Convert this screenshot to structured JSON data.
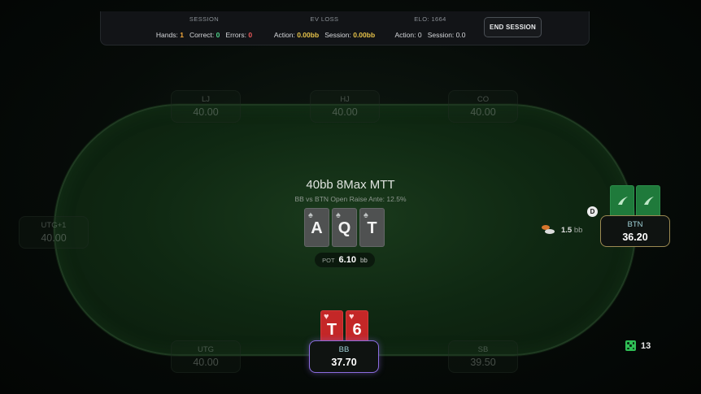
{
  "stats": {
    "session": {
      "header": "SESSION",
      "hands_label": "Hands:",
      "hands": "1",
      "correct_label": "Correct:",
      "correct": "0",
      "errors_label": "Errors:",
      "errors": "0"
    },
    "ev_loss": {
      "header": "EV LOSS",
      "action_label": "Action:",
      "action": "0.00bb",
      "session_label": "Session:",
      "session": "0.00bb"
    },
    "elo": {
      "header": "ELO: 1664",
      "action_label": "Action:",
      "action": "0",
      "session_label": "Session:",
      "session": "0.0"
    },
    "end_button": "END SESSION"
  },
  "table": {
    "title": "40bb 8Max MTT",
    "subtitle": "BB vs BTN Open Raise Ante: 12.5%",
    "pot_label": "POT",
    "pot_value": "6.10",
    "pot_unit": "bb"
  },
  "seats": [
    {
      "id": "lj",
      "pos": "LJ",
      "stack": "40.00"
    },
    {
      "id": "hj",
      "pos": "HJ",
      "stack": "40.00"
    },
    {
      "id": "co",
      "pos": "CO",
      "stack": "40.00"
    },
    {
      "id": "utg1",
      "pos": "UTG+1",
      "stack": "40.00"
    },
    {
      "id": "btn",
      "pos": "BTN",
      "stack": "36.20"
    },
    {
      "id": "utg",
      "pos": "UTG",
      "stack": "40.00"
    },
    {
      "id": "bb",
      "pos": "BB",
      "stack": "37.70"
    },
    {
      "id": "sb",
      "pos": "SB",
      "stack": "39.50"
    }
  ],
  "board": [
    {
      "rank": "A",
      "suit": "♠"
    },
    {
      "rank": "Q",
      "suit": "♠"
    },
    {
      "rank": "T",
      "suit": "♠"
    }
  ],
  "hero_cards": [
    {
      "rank": "T",
      "suit": "♥"
    },
    {
      "rank": "6",
      "suit": "♥"
    }
  ],
  "dealer_button": "D",
  "btn_bet": {
    "value": "1.5",
    "unit": "bb"
  },
  "dice_count": "13",
  "colors": {
    "hero_border": "#8c6ce0",
    "btn_border": "#9c8a52",
    "card_red": "#c42727",
    "card_back": "#1f7a3b"
  }
}
